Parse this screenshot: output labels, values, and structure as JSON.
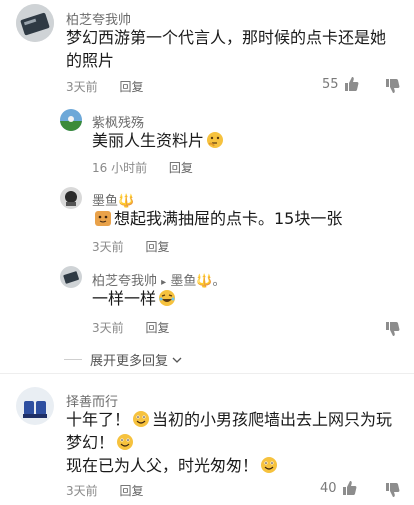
{
  "comments": [
    {
      "author": "柏芝夸我帅",
      "text_line1": "梦幻西游第一个代言人，那时候的点卡还是她",
      "text_line2": "的照片",
      "time": "3天前",
      "reply": "回复",
      "likes": "55"
    },
    {
      "author": "紫枫残殇",
      "text": "美丽人生资料片",
      "time": "16 小时前",
      "reply": "回复"
    },
    {
      "author": "墨鱼🔱",
      "text": "想起我满抽屉的点卡。15块一张",
      "time": "3天前",
      "reply": "回复"
    },
    {
      "author": "柏芝夸我帅",
      "reply_arrow": "▸",
      "reply_to": "墨鱼🔱。",
      "text": "一样一样",
      "time": "3天前",
      "reply": "回复"
    },
    {
      "author": "择善而行",
      "text_line1_a": "十年了！",
      "text_line1_b": "当初的小男孩爬墙出去上网只为玩",
      "text_line2": "梦幻！",
      "text_line3": "现在已为人父，时光匆匆！",
      "time": "3天前",
      "reply": "回复",
      "likes": "40"
    }
  ],
  "expand_more": "展开更多回复",
  "icons": [
    "thumbs-up-icon",
    "thumbs-down-icon",
    "chevron-down-icon",
    "thinking-emoji-icon",
    "smile-emoji-icon",
    "laugh-emoji-icon"
  ],
  "colors": {
    "name": "#6b6b6b",
    "meta": "#8a8a8a",
    "text": "#1a1a1a"
  }
}
